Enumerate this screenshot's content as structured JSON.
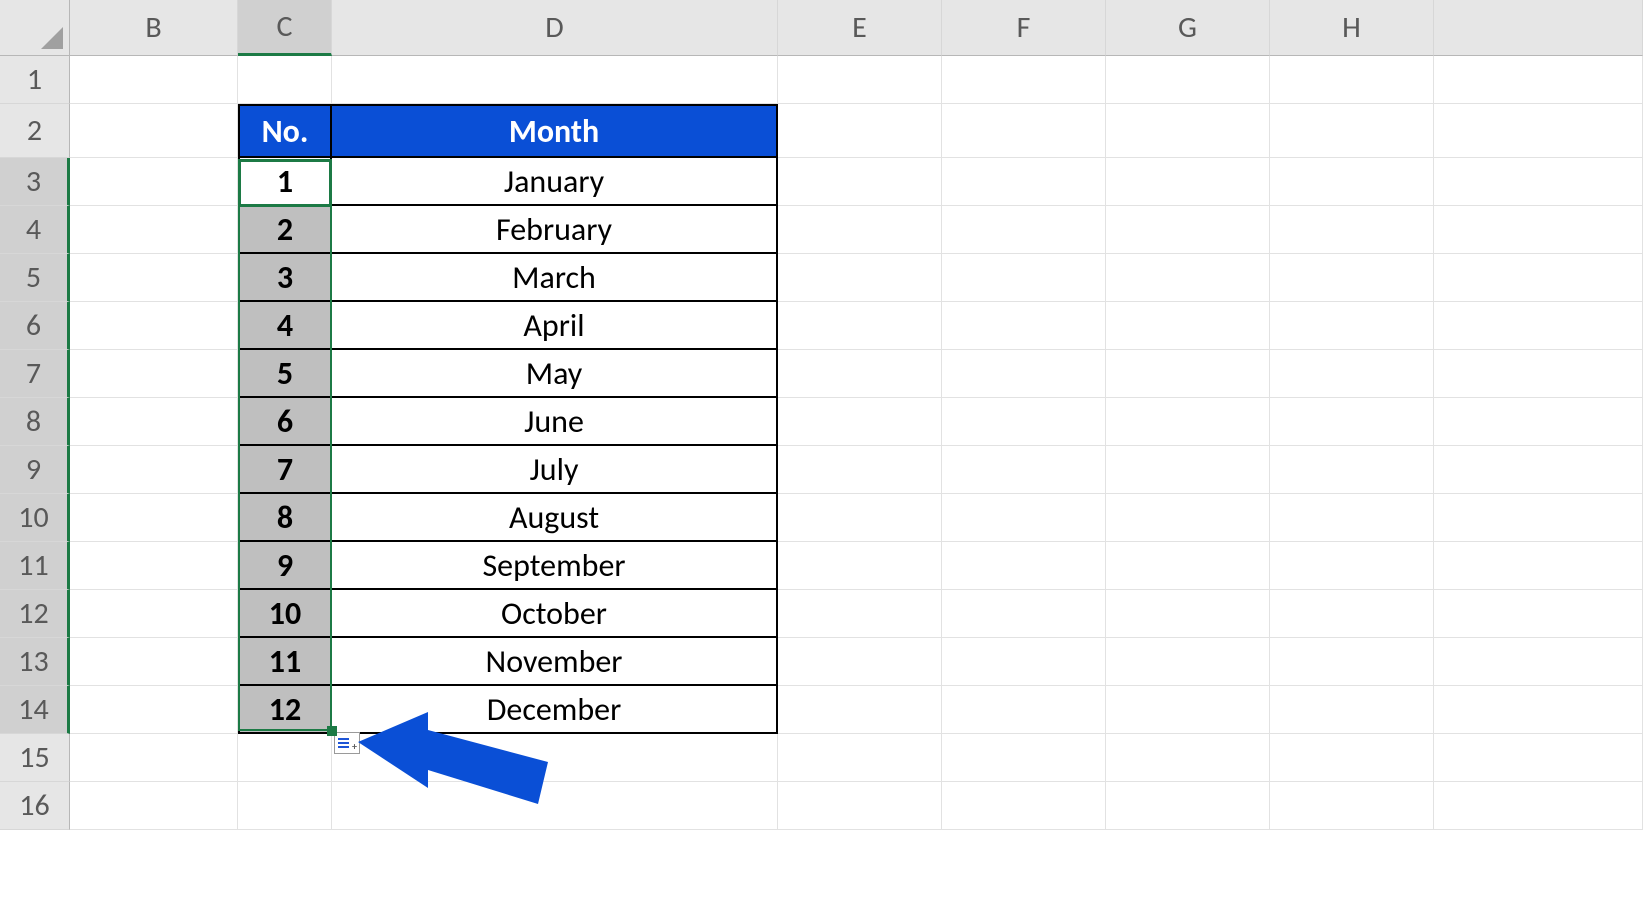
{
  "columns": [
    "B",
    "C",
    "D",
    "E",
    "F",
    "G",
    "H"
  ],
  "selectedColumn": "C",
  "rows": [
    "1",
    "2",
    "3",
    "4",
    "5",
    "6",
    "7",
    "8",
    "9",
    "10",
    "11",
    "12",
    "13",
    "14",
    "15",
    "16"
  ],
  "selectedRows": [
    "3",
    "4",
    "5",
    "6",
    "7",
    "8",
    "9",
    "10",
    "11",
    "12",
    "13",
    "14"
  ],
  "table": {
    "headerRow": "2",
    "headerNo": "No.",
    "headerMonth": "Month",
    "headerBg": "#0a4fd6",
    "data": [
      {
        "no": "1",
        "month": "January"
      },
      {
        "no": "2",
        "month": "February"
      },
      {
        "no": "3",
        "month": "March"
      },
      {
        "no": "4",
        "month": "April"
      },
      {
        "no": "5",
        "month": "May"
      },
      {
        "no": "6",
        "month": "June"
      },
      {
        "no": "7",
        "month": "July"
      },
      {
        "no": "8",
        "month": "August"
      },
      {
        "no": "9",
        "month": "September"
      },
      {
        "no": "10",
        "month": "October"
      },
      {
        "no": "11",
        "month": "November"
      },
      {
        "no": "12",
        "month": "December"
      }
    ]
  },
  "activeCell": {
    "col": "C",
    "row": "3"
  },
  "autoFillOptions": {
    "visible": true
  }
}
